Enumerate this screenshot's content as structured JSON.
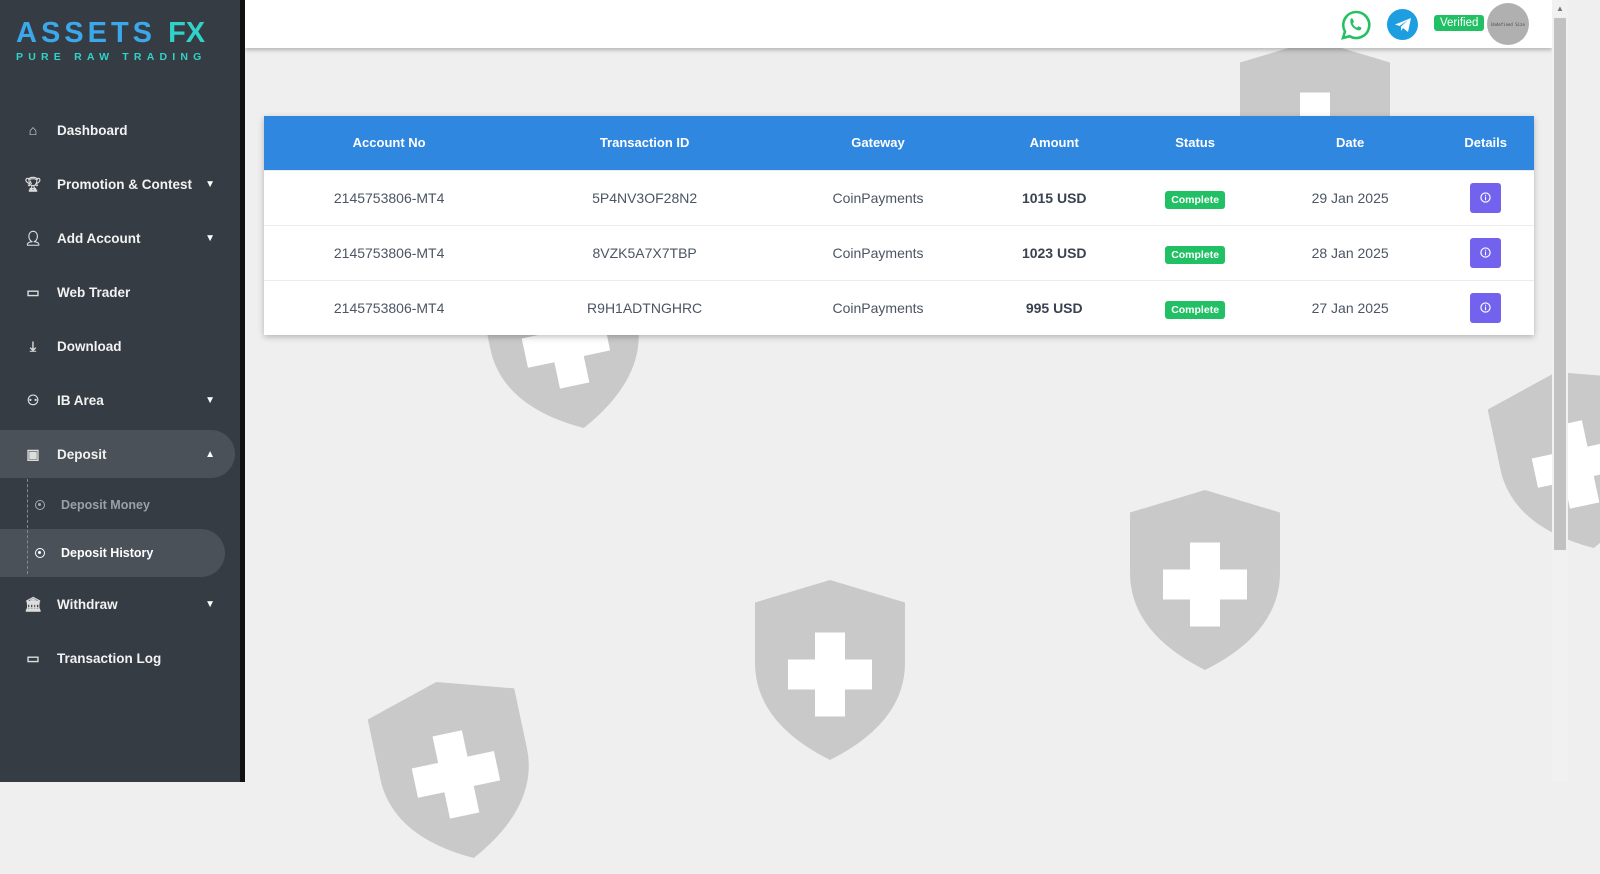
{
  "brand": {
    "name": "ASSETS",
    "suffix": "FX",
    "tagline": "PURE RAW TRADING"
  },
  "sidebar": {
    "items": [
      {
        "label": "Dashboard",
        "icon": "home-icon"
      },
      {
        "label": "Promotion & Contest",
        "icon": "trophy-icon"
      },
      {
        "label": "Add Account",
        "icon": "add-user-icon"
      },
      {
        "label": "Web Trader",
        "icon": "chart-icon"
      },
      {
        "label": "Download",
        "icon": "download-icon"
      },
      {
        "label": "IB Area",
        "icon": "network-icon"
      },
      {
        "label": "Deposit",
        "icon": "wallet-icon"
      },
      {
        "label": "Withdraw",
        "icon": "bank-icon"
      },
      {
        "label": "Transaction Log",
        "icon": "card-icon"
      }
    ],
    "deposit_sub": [
      {
        "label": "Deposit Money"
      },
      {
        "label": "Deposit History"
      }
    ]
  },
  "header": {
    "verified": "Verified",
    "avatar_text": "Undefined Size"
  },
  "table": {
    "columns": [
      "Account No",
      "Transaction ID",
      "Gateway",
      "Amount",
      "Status",
      "Date",
      "Details"
    ],
    "rows": [
      {
        "account": "2145753806-MT4",
        "txid": "5P4NV3OF28N2",
        "gateway": "CoinPayments",
        "amount": "1015 USD",
        "status": "Complete",
        "date": "29 Jan 2025"
      },
      {
        "account": "2145753806-MT4",
        "txid": "8VZK5A7X7TBP",
        "gateway": "CoinPayments",
        "amount": "1023 USD",
        "status": "Complete",
        "date": "28 Jan 2025"
      },
      {
        "account": "2145753806-MT4",
        "txid": "R9H1ADTNGHRC",
        "gateway": "CoinPayments",
        "amount": "995 USD",
        "status": "Complete",
        "date": "27 Jan 2025"
      }
    ]
  }
}
